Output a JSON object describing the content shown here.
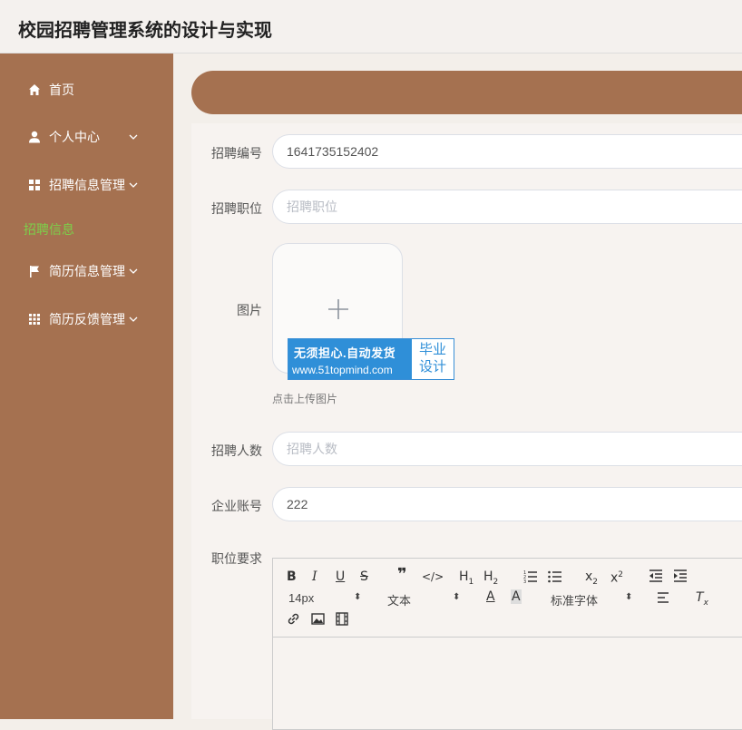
{
  "header": {
    "title": "校园招聘管理系统的设计与实现"
  },
  "sidebar": {
    "items": [
      {
        "label": "首页",
        "icon": "home-icon"
      },
      {
        "label": "个人中心",
        "icon": "user-icon"
      },
      {
        "label": "招聘信息管理",
        "icon": "grid-icon"
      },
      {
        "label": "简历信息管理",
        "icon": "flag-icon"
      },
      {
        "label": "简历反馈管理",
        "icon": "apps-icon"
      }
    ],
    "active_subitem": "招聘信息"
  },
  "form": {
    "recruit_no": {
      "label": "招聘编号",
      "value": "1641735152402"
    },
    "position": {
      "label": "招聘职位",
      "placeholder": "招聘职位"
    },
    "image": {
      "label": "图片",
      "hint": "点击上传图片"
    },
    "headcount": {
      "label": "招聘人数",
      "placeholder": "招聘人数"
    },
    "company_account": {
      "label": "企业账号",
      "value": "222"
    },
    "requirements": {
      "label": "职位要求"
    }
  },
  "editor": {
    "font_size": "14px",
    "text_type": "文本",
    "font_family": "标准字体"
  },
  "watermark": {
    "line1": "无须担心.自动发货",
    "line2": "www.51topmind.com",
    "right1": "毕业",
    "right2": "设计"
  },
  "colors": {
    "sidebar": "#a57150",
    "active_submenu": "#7cd04a",
    "watermark_blue": "#2f8fd8"
  }
}
